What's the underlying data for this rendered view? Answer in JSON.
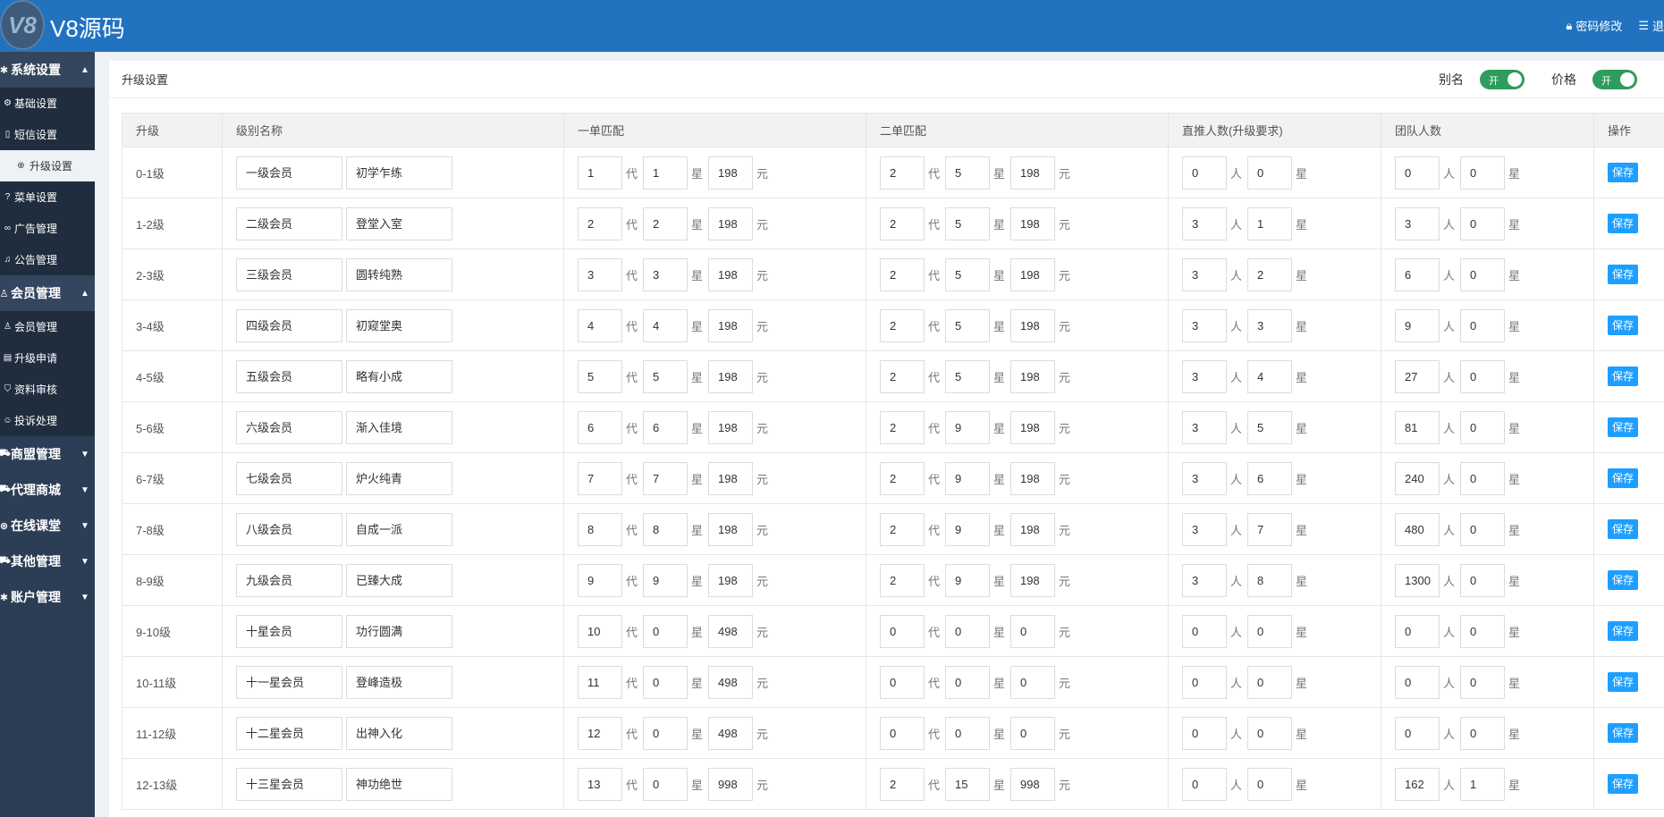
{
  "app": {
    "logo_text": "V8",
    "title": "V8源码"
  },
  "top_links": [
    {
      "icon": "lock-icon",
      "label": "密码修改"
    },
    {
      "icon": "menu-icon",
      "label": "退"
    }
  ],
  "sidebar": {
    "groups": [
      {
        "label": "系统设置",
        "icon": "gear-icon",
        "expanded": true,
        "items": [
          {
            "label": "基础设置",
            "icon": "gear-icon"
          },
          {
            "label": "短信设置",
            "icon": "phone-icon"
          },
          {
            "label": "升级设置",
            "icon": "upload-icon",
            "active": true
          },
          {
            "label": "菜单设置",
            "icon": "help-icon"
          },
          {
            "label": "广告管理",
            "icon": "link-icon"
          },
          {
            "label": "公告管理",
            "icon": "bell-icon"
          }
        ]
      },
      {
        "label": "会员管理",
        "icon": "user-icon",
        "expanded": true,
        "items": [
          {
            "label": "会员管理",
            "icon": "user-icon"
          },
          {
            "label": "升级申请",
            "icon": "doc-icon"
          },
          {
            "label": "资料审核",
            "icon": "shield-icon"
          },
          {
            "label": "投诉处理",
            "icon": "smile-icon"
          }
        ]
      },
      {
        "label": "商盟管理",
        "icon": "cart-icon",
        "expanded": false
      },
      {
        "label": "代理商城",
        "icon": "cart-icon",
        "expanded": false
      },
      {
        "label": "在线课堂",
        "icon": "play-icon",
        "expanded": false
      },
      {
        "label": "其他管理",
        "icon": "cart-icon",
        "expanded": false
      },
      {
        "label": "账户管理",
        "icon": "gear-icon",
        "expanded": false
      }
    ]
  },
  "panel": {
    "title": "升级设置",
    "toggles": [
      {
        "label": "别名",
        "state": "开"
      },
      {
        "label": "价格",
        "state": "开"
      }
    ]
  },
  "table": {
    "headers": [
      "升级",
      "级别名称",
      "一单匹配",
      "二单匹配",
      "直推人数(升级要求)",
      "团队人数",
      "操作"
    ],
    "units": {
      "dai": "代",
      "xing": "星",
      "yuan": "元",
      "ren": "人"
    },
    "save_label": "保存",
    "rows": [
      {
        "level": "0-1级",
        "name": "一级会员",
        "alias": "初学乍练",
        "m1": [
          "1",
          "1",
          "198"
        ],
        "m2": [
          "2",
          "5",
          "198"
        ],
        "direct": [
          "0",
          "0"
        ],
        "team": [
          "0",
          "0"
        ]
      },
      {
        "level": "1-2级",
        "name": "二级会员",
        "alias": "登堂入室",
        "m1": [
          "2",
          "2",
          "198"
        ],
        "m2": [
          "2",
          "5",
          "198"
        ],
        "direct": [
          "3",
          "1"
        ],
        "team": [
          "3",
          "0"
        ]
      },
      {
        "level": "2-3级",
        "name": "三级会员",
        "alias": "圆转纯熟",
        "m1": [
          "3",
          "3",
          "198"
        ],
        "m2": [
          "2",
          "5",
          "198"
        ],
        "direct": [
          "3",
          "2"
        ],
        "team": [
          "6",
          "0"
        ]
      },
      {
        "level": "3-4级",
        "name": "四级会员",
        "alias": "初窥堂奥",
        "m1": [
          "4",
          "4",
          "198"
        ],
        "m2": [
          "2",
          "5",
          "198"
        ],
        "direct": [
          "3",
          "3"
        ],
        "team": [
          "9",
          "0"
        ]
      },
      {
        "level": "4-5级",
        "name": "五级会员",
        "alias": "略有小成",
        "m1": [
          "5",
          "5",
          "198"
        ],
        "m2": [
          "2",
          "5",
          "198"
        ],
        "direct": [
          "3",
          "4"
        ],
        "team": [
          "27",
          "0"
        ]
      },
      {
        "level": "5-6级",
        "name": "六级会员",
        "alias": "渐入佳境",
        "m1": [
          "6",
          "6",
          "198"
        ],
        "m2": [
          "2",
          "9",
          "198"
        ],
        "direct": [
          "3",
          "5"
        ],
        "team": [
          "81",
          "0"
        ]
      },
      {
        "level": "6-7级",
        "name": "七级会员",
        "alias": "炉火纯青",
        "m1": [
          "7",
          "7",
          "198"
        ],
        "m2": [
          "2",
          "9",
          "198"
        ],
        "direct": [
          "3",
          "6"
        ],
        "team": [
          "240",
          "0"
        ]
      },
      {
        "level": "7-8级",
        "name": "八级会员",
        "alias": "自成一派",
        "m1": [
          "8",
          "8",
          "198"
        ],
        "m2": [
          "2",
          "9",
          "198"
        ],
        "direct": [
          "3",
          "7"
        ],
        "team": [
          "480",
          "0"
        ]
      },
      {
        "level": "8-9级",
        "name": "九级会员",
        "alias": "已臻大成",
        "m1": [
          "9",
          "9",
          "198"
        ],
        "m2": [
          "2",
          "9",
          "198"
        ],
        "direct": [
          "3",
          "8"
        ],
        "team": [
          "1300",
          "0"
        ]
      },
      {
        "level": "9-10级",
        "name": "十星会员",
        "alias": "功行圆满",
        "m1": [
          "10",
          "0",
          "498"
        ],
        "m2": [
          "0",
          "0",
          "0"
        ],
        "direct": [
          "0",
          "0"
        ],
        "team": [
          "0",
          "0"
        ]
      },
      {
        "level": "10-11级",
        "name": "十一星会员",
        "alias": "登峰造极",
        "m1": [
          "11",
          "0",
          "498"
        ],
        "m2": [
          "0",
          "0",
          "0"
        ],
        "direct": [
          "0",
          "0"
        ],
        "team": [
          "0",
          "0"
        ]
      },
      {
        "level": "11-12级",
        "name": "十二星会员",
        "alias": "出神入化",
        "m1": [
          "12",
          "0",
          "498"
        ],
        "m2": [
          "0",
          "0",
          "0"
        ],
        "direct": [
          "0",
          "0"
        ],
        "team": [
          "0",
          "0"
        ]
      },
      {
        "level": "12-13级",
        "name": "十三星会员",
        "alias": "神功绝世",
        "m1": [
          "13",
          "0",
          "998"
        ],
        "m2": [
          "2",
          "15",
          "998"
        ],
        "direct": [
          "0",
          "0"
        ],
        "team": [
          "162",
          "1"
        ]
      }
    ]
  },
  "colors": {
    "topbar": "#2173c0",
    "sidebar": "#2c3e55",
    "switch_on": "#2e9c5c",
    "save_button": "#1e9fff"
  }
}
